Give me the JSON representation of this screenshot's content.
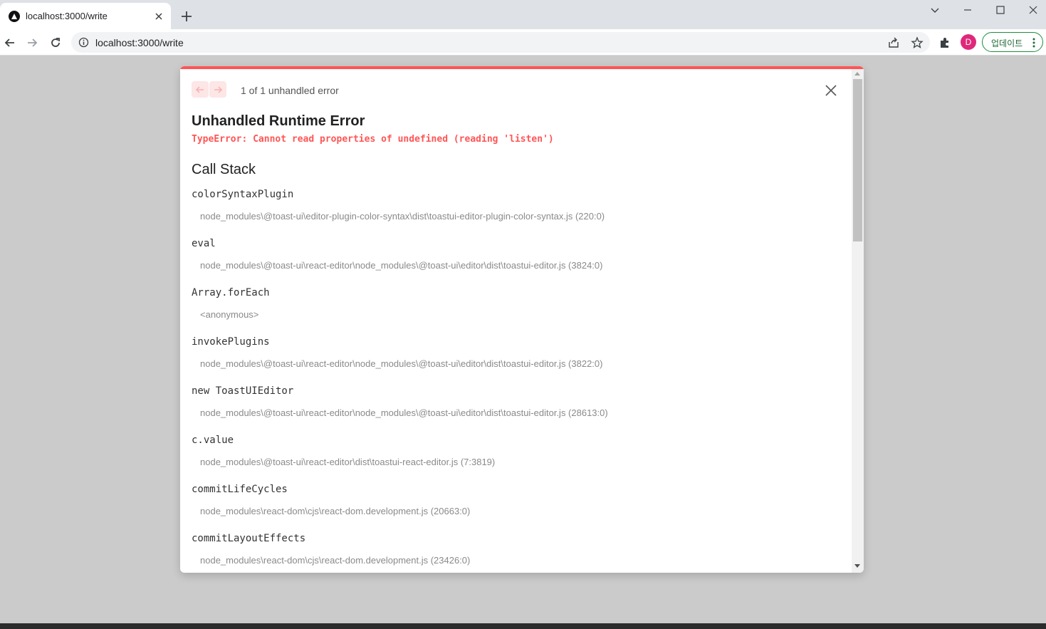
{
  "browser": {
    "tab_title": "localhost:3000/write",
    "url": "localhost:3000/write",
    "avatar_initial": "D",
    "update_label": "업데이트"
  },
  "dialog": {
    "error_count_text": "1 of 1 unhandled error",
    "title": "Unhandled Runtime Error",
    "message": "TypeError: Cannot read properties of undefined (reading 'listen')",
    "call_stack_title": "Call Stack",
    "frames": [
      {
        "fn": "colorSyntaxPlugin",
        "loc": "node_modules\\@toast-ui\\editor-plugin-color-syntax\\dist\\toastui-editor-plugin-color-syntax.js (220:0)"
      },
      {
        "fn": "eval",
        "loc": "node_modules\\@toast-ui\\react-editor\\node_modules\\@toast-ui\\editor\\dist\\toastui-editor.js (3824:0)"
      },
      {
        "fn": "Array.forEach",
        "loc": "<anonymous>"
      },
      {
        "fn": "invokePlugins",
        "loc": "node_modules\\@toast-ui\\react-editor\\node_modules\\@toast-ui\\editor\\dist\\toastui-editor.js (3822:0)"
      },
      {
        "fn": "new ToastUIEditor",
        "loc": "node_modules\\@toast-ui\\react-editor\\node_modules\\@toast-ui\\editor\\dist\\toastui-editor.js (28613:0)"
      },
      {
        "fn": "c.value",
        "loc": "node_modules\\@toast-ui\\react-editor\\dist\\toastui-react-editor.js (7:3819)"
      },
      {
        "fn": "commitLifeCycles",
        "loc": "node_modules\\react-dom\\cjs\\react-dom.development.js (20663:0)"
      },
      {
        "fn": "commitLayoutEffects",
        "loc": "node_modules\\react-dom\\cjs\\react-dom.development.js (23426:0)"
      }
    ]
  }
}
